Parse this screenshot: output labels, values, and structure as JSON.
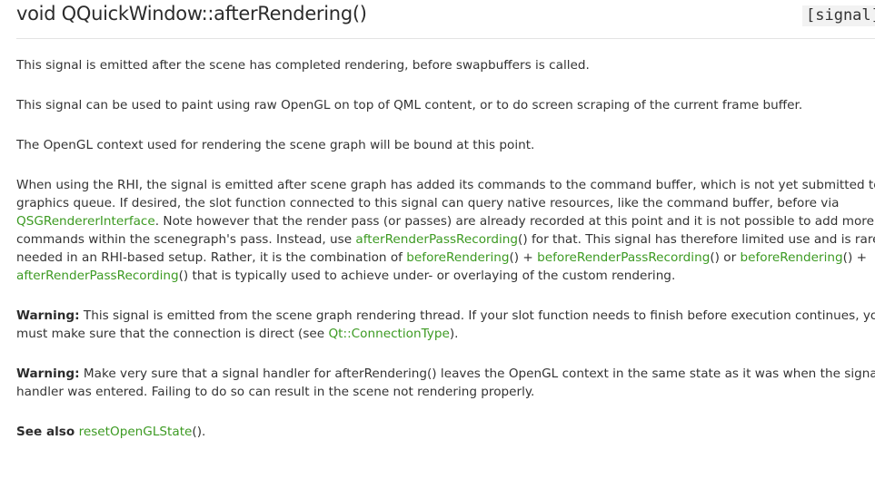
{
  "header": {
    "title": "void QQuickWindow::afterRendering()",
    "tag": "[signal]"
  },
  "p1": {
    "text": "This signal is emitted after the scene has completed rendering, before swapbuffers is called."
  },
  "p2": {
    "text": "This signal can be used to paint using raw OpenGL on top of QML content, or to do screen scraping of the current frame buffer."
  },
  "p3": {
    "text": "The OpenGL context used for rendering the scene graph will be bound at this point."
  },
  "p4": {
    "l1": "When using the RHI, the signal is emitted after scene graph has added its commands to the command buffer, which is not yet submitted to the",
    "l2": "graphics queue. If desired, the slot function connected to this signal can query native resources, like the command buffer, before via",
    "l3_link": "QSGRendererInterface",
    "l3_rest": ". Note however that the render pass (or passes) are already recorded at this point and it is not possible to add more",
    "l4_a": "commands within the scenegraph's pass. Instead, use ",
    "l4_link": "afterRenderPassRecording",
    "l4_b": "() for that. This signal has therefore limited use and is rarely",
    "l5_a": "needed in an RHI-based setup. Rather, it is the combination of ",
    "l5_link1": "beforeRendering",
    "l5_b": "() + ",
    "l5_link2": "beforeRenderPassRecording",
    "l5_c": "() or ",
    "l5_link3": "beforeRendering",
    "l5_d": "() +",
    "l6_link": "afterRenderPassRecording",
    "l6_rest": "() that is typically used to achieve under- or overlaying of the custom rendering."
  },
  "p5": {
    "label": "Warning:",
    "l1": " This signal is emitted from the scene graph rendering thread. If your slot function needs to finish before execution continues, you",
    "l2_a": "must make sure that the connection is direct (see ",
    "l2_link": "Qt::ConnectionType",
    "l2_b": ")."
  },
  "p6": {
    "label": "Warning:",
    "l1": " Make very sure that a signal handler for afterRendering() leaves the OpenGL context in the same state as it was when the signal",
    "l2": "handler was entered. Failing to do so can result in the scene not rendering properly."
  },
  "p7": {
    "label": "See also",
    "space": " ",
    "link": "resetOpenGLState",
    "rest": "()."
  }
}
